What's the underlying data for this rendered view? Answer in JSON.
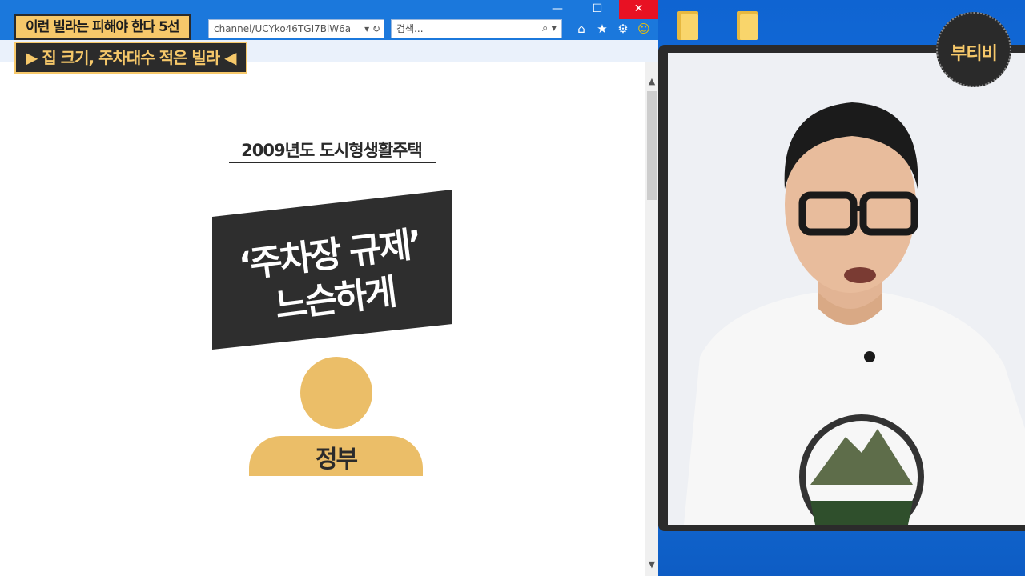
{
  "captions": {
    "line1": "이런 빌라는 피해야 한다 5선",
    "line2": "▶ 집 크기, 주차대수 적은 빌라 ◀"
  },
  "browser": {
    "window_controls": {
      "minimize": "—",
      "maximize": "☐",
      "close": "✕"
    },
    "address_text": "channel/UCYko46TGI7BlW6a",
    "address_icons": "▾ ↻",
    "search_placeholder": "검색...",
    "search_icons": "⌕ ▾",
    "toolbar_icons": {
      "home": "⌂",
      "favorites": "★",
      "settings": "⚙",
      "feedback": "☺"
    },
    "scroll": {
      "up": "▲",
      "down": "▼"
    }
  },
  "slide": {
    "headline": "2009년도 도시형생활주택",
    "banner_line1": "‘주차장 규제’",
    "banner_line2": "느슨하게",
    "person_label": "정부"
  },
  "logo": {
    "text": "부티비"
  },
  "colors": {
    "accent_yellow": "#f6c86a",
    "figure_gold": "#ebbe68",
    "banner_dark": "#2e2e2e",
    "desktop_blue": "#1a72d8"
  }
}
